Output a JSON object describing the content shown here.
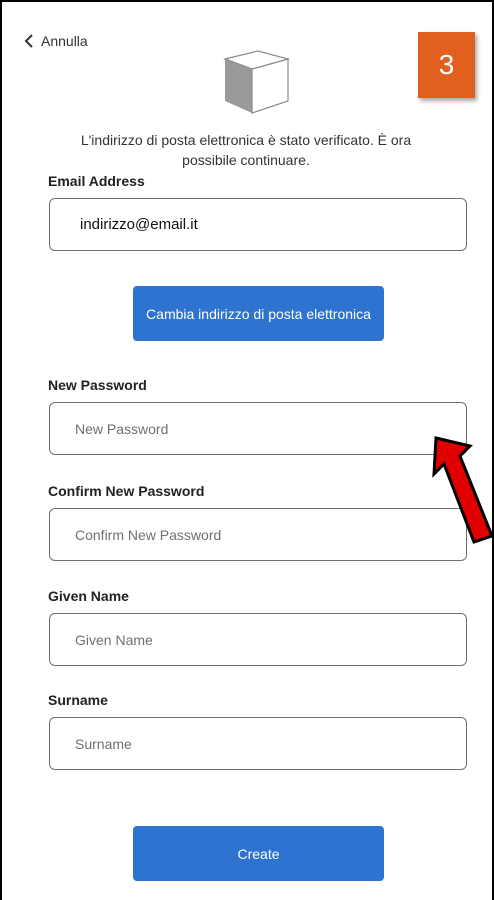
{
  "back": {
    "label": "Annulla"
  },
  "step_badge": "3",
  "verification_message": "L'indirizzo di posta elettronica è stato verificato. È ora possibile continuare.",
  "fields": {
    "email": {
      "label": "Email Address",
      "value": "indirizzo@email.it"
    },
    "new_password": {
      "label": "New Password",
      "placeholder": "New Password"
    },
    "confirm_password": {
      "label": "Confirm New Password",
      "placeholder": "Confirm New Password"
    },
    "given_name": {
      "label": "Given Name",
      "placeholder": "Given Name"
    },
    "surname": {
      "label": "Surname",
      "placeholder": "Surname"
    }
  },
  "buttons": {
    "change_email": "Cambia indirizzo di posta elettronica",
    "create": "Create"
  },
  "colors": {
    "primary": "#2e73d0",
    "badge": "#e2601d",
    "arrow_fill": "#e00000"
  },
  "icons": [
    "chevron-left-icon",
    "cube-logo-icon",
    "red-arrow-annotation"
  ]
}
